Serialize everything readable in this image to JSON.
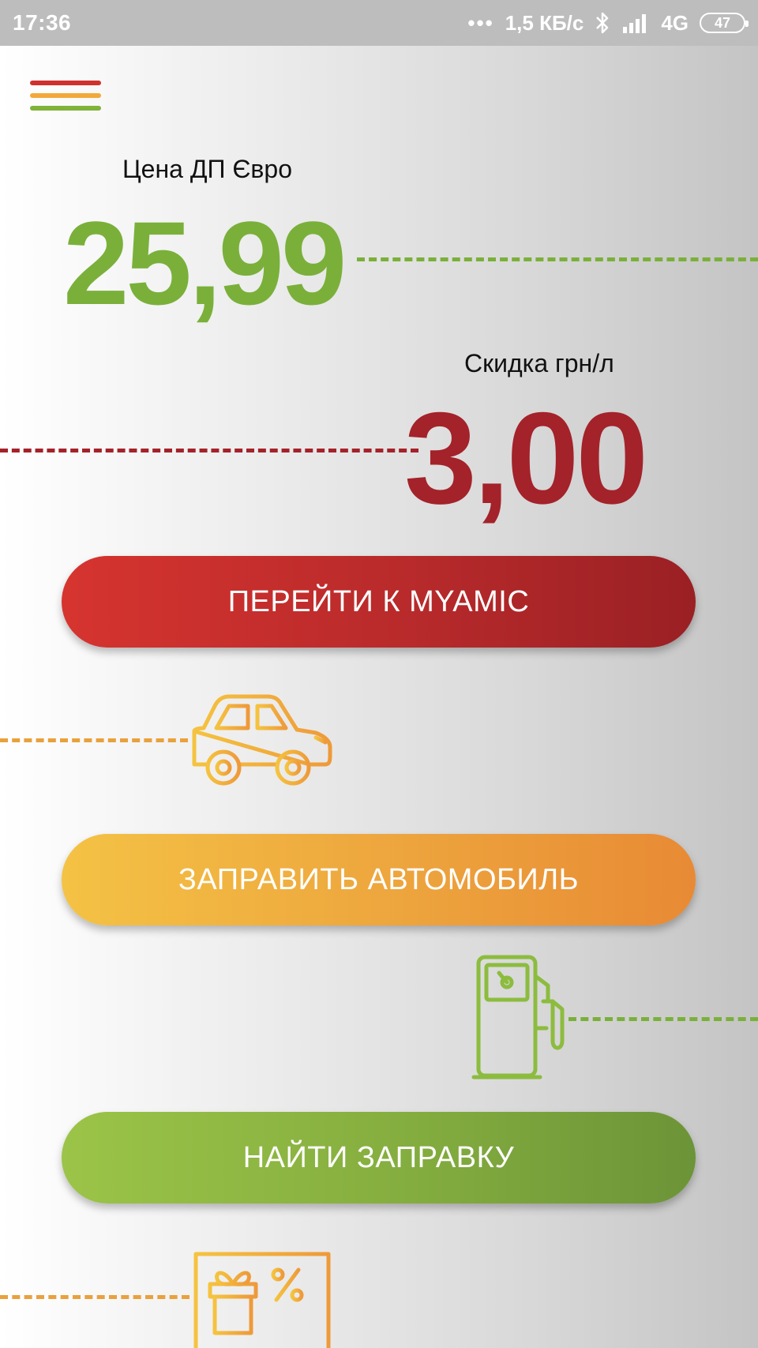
{
  "status_bar": {
    "time": "17:36",
    "dots": "•••",
    "speed": "1,5 КБ/с",
    "network": "4G",
    "battery": "47"
  },
  "price": {
    "label": "Цена ДП Євро",
    "value": "25,99"
  },
  "discount": {
    "label": "Скидка грн/л",
    "value": "3,00"
  },
  "buttons": {
    "myamic": "ПЕРЕЙТИ К MYAMIC",
    "refuel": "ЗАПРАВИТЬ АВТОМОБИЛЬ",
    "find": "НАЙТИ ЗАПРАВКУ"
  },
  "icons": {
    "menu": "hamburger-menu-icon",
    "car": "car-icon",
    "pump": "fuel-pump-icon",
    "gift": "gift-card-icon",
    "bluetooth": "bluetooth-icon",
    "signal": "signal-icon"
  },
  "colors": {
    "red": "#a4222a",
    "orange": "#e9a13d",
    "green": "#7ab03a"
  }
}
